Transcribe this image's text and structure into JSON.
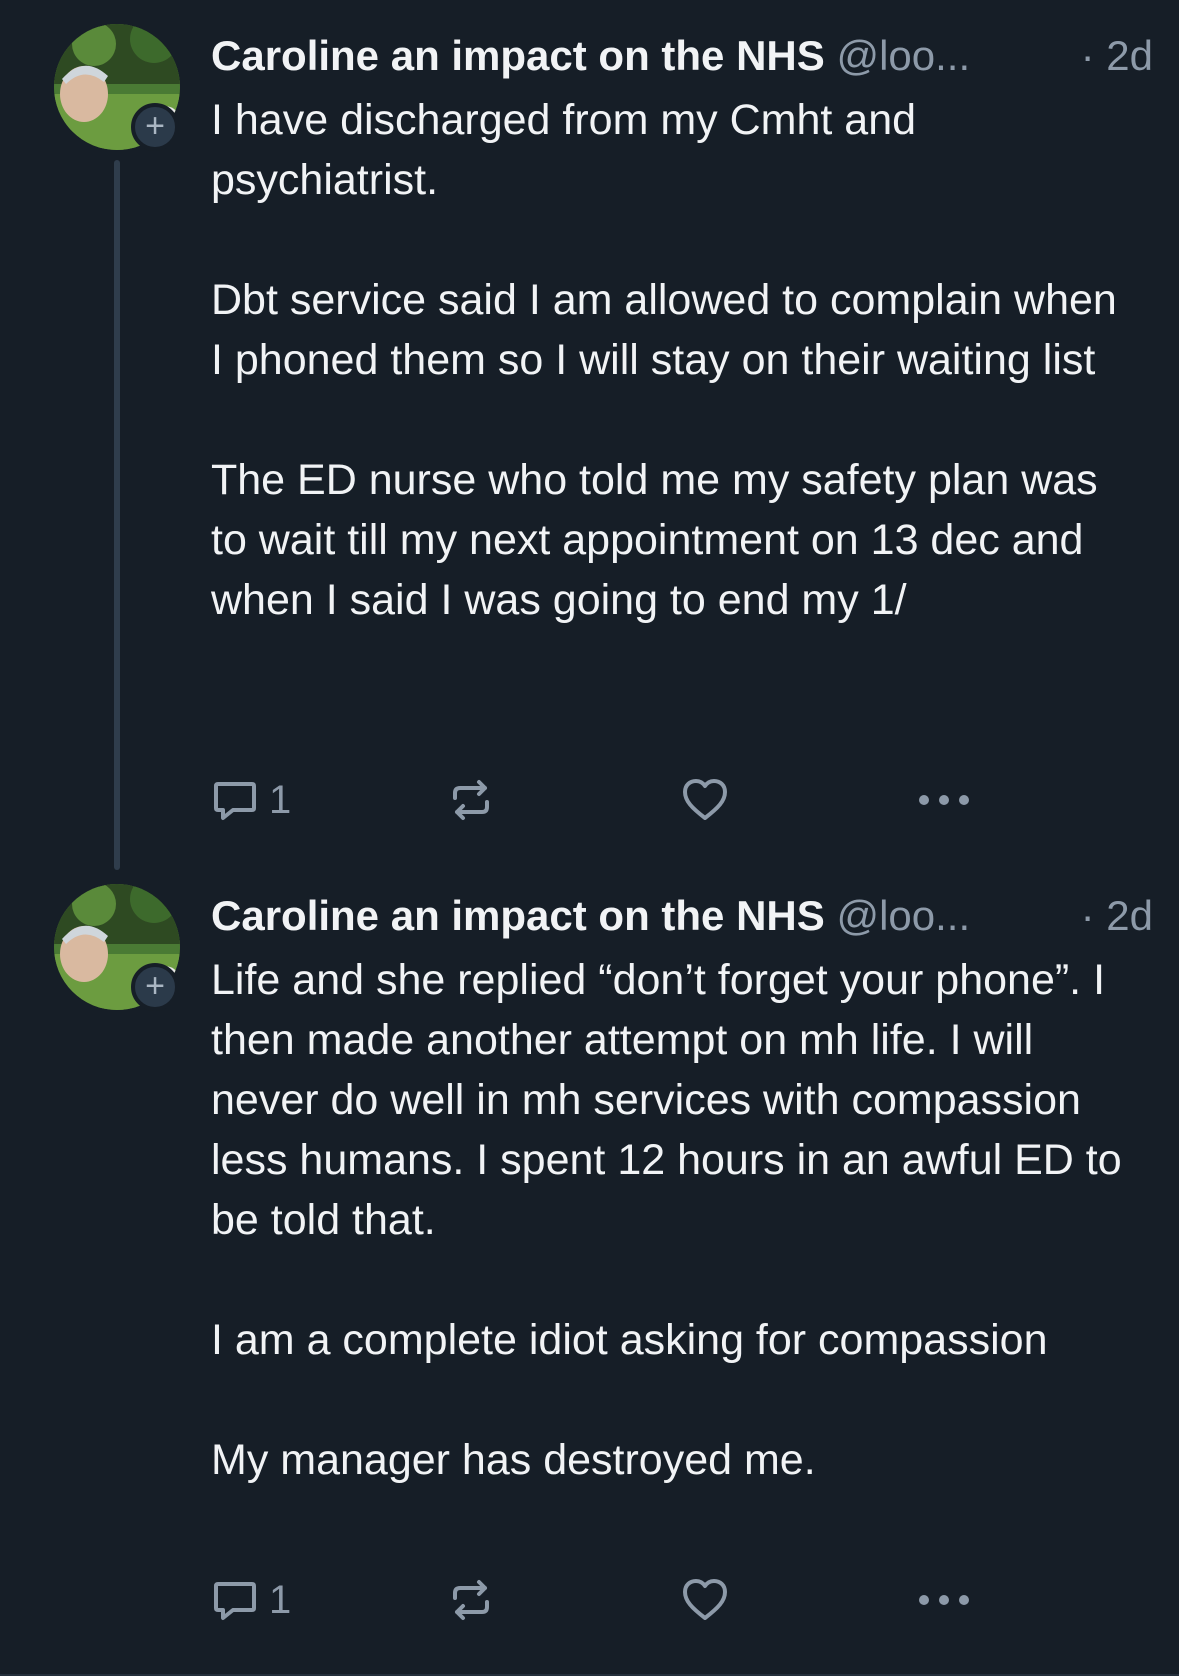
{
  "posts": [
    {
      "display_name": "Caroline an impact on the NHS",
      "handle": "@loo...",
      "time": "· 2d",
      "paragraphs": [
        "I have discharged from my Cmht and psychiatrist.",
        "Dbt service said I am allowed to complain when I phoned them so I will stay on their waiting list",
        "The ED nurse who told me my safety plan was to wait till my next appointment on 13 dec and when I said I was going to end my 1/"
      ],
      "reply_count": "1",
      "follow_badge": "+"
    },
    {
      "display_name": "Caroline an impact on the NHS",
      "handle": "@loo...",
      "time": "· 2d",
      "paragraphs": [
        "Life and she replied “don’t forget your phone”.  I then made another attempt on mh life.  I will never do well in mh services with compassion less humans.  I spent 12 hours in an awful ED to be told that.",
        "I am a complete idiot asking for compassion",
        "My manager has destroyed me."
      ],
      "reply_count": "1",
      "follow_badge": "+"
    }
  ],
  "colors": {
    "background": "#161e27",
    "text": "#f1f3f5",
    "secondary_text": "#8d9aa9",
    "thread_line": "#2f3d4c"
  },
  "icons": {
    "reply": "speech-bubble-icon",
    "repost": "repost-arrows-icon",
    "like": "heart-outline-icon",
    "more": "ellipsis-icon",
    "follow": "plus-icon"
  }
}
